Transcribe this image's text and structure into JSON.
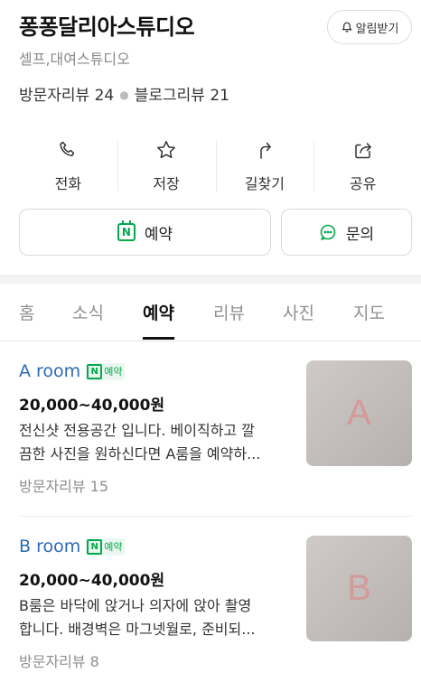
{
  "place": {
    "name": "퐁퐁달리아스튜디오",
    "category": "셀프,대여스튜디오",
    "visitor_reviews": "방문자리뷰 24",
    "blog_reviews": "블로그리뷰 21",
    "notify_label": "알림받기"
  },
  "actions": [
    {
      "label": "전화",
      "icon": "phone-icon"
    },
    {
      "label": "저장",
      "icon": "star-icon"
    },
    {
      "label": "길찾기",
      "icon": "directions-icon"
    },
    {
      "label": "공유",
      "icon": "share-icon"
    }
  ],
  "buttons": {
    "reserve_label": "예약",
    "reserve_badge": "N",
    "inquiry_label": "문의"
  },
  "tabs": [
    {
      "label": "홈",
      "active": false
    },
    {
      "label": "소식",
      "active": false
    },
    {
      "label": "예약",
      "active": true
    },
    {
      "label": "리뷰",
      "active": false
    },
    {
      "label": "사진",
      "active": false
    },
    {
      "label": "지도",
      "active": false
    }
  ],
  "items": [
    {
      "name": "A room",
      "badge_n": "N",
      "badge_text": "예약",
      "price": "20,000~40,000원",
      "desc_line1": "전신샷 전용공간 입니다. 베이직하고 깔",
      "desc_line2": "끔한 사진을 원하신다면 A룸을 예약하...",
      "reviews": "방문자리뷰 15",
      "thumb_letter": "A"
    },
    {
      "name": "B room",
      "badge_n": "N",
      "badge_text": "예약",
      "price": "20,000~40,000원",
      "desc_line1": "B룸은 바닥에 앉거나 의자에 앉아 촬영",
      "desc_line2": "합니다. 배경벽은 마그넷월로, 준비되...",
      "reviews": "방문자리뷰 8",
      "thumb_letter": "B"
    }
  ],
  "colors": {
    "naver_green": "#03a94d",
    "link_blue": "#2d6ab3",
    "muted_gray": "#8f8f8f"
  }
}
